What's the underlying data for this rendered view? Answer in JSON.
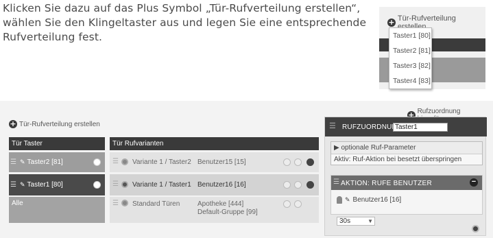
{
  "intro": {
    "text": "Klicken Sie dazu auf das Plus Symbol „Tür-Rufverteilung erstellen“, wählen Sie den Klingeltaster aus und legen Sie eine entsprechende Rufverteilung fest."
  },
  "inset": {
    "add_label": "Tür-Rufverteilung erstellen",
    "options": [
      "Taster1 [80]",
      "Taster2 [81]",
      "Taster3 [82]",
      "Taster4 [83]"
    ]
  },
  "app": {
    "add_label": "Tür-Rufverteilung erstellen",
    "add_assignment_label": "Rufzuordnung hinzufügen",
    "col_taster": "Tür Taster",
    "col_variants": "Tür Rufvarianten",
    "taster": [
      {
        "label": "Taster2 [81]"
      },
      {
        "label": "Taster1 [80]"
      },
      {
        "label": "Alle"
      }
    ],
    "variants": [
      {
        "name": "Variante 1 / Taster2",
        "user": "Benutzer15 [15]",
        "user2": ""
      },
      {
        "name": "Variante 1 / Taster1",
        "user": "Benutzer16 [16]",
        "user2": ""
      },
      {
        "name": "Standard Türen",
        "user": "Apotheke [444]",
        "user2": "Default-Gruppe [99]"
      }
    ],
    "panel": {
      "title": "RUFZUORDNUNG",
      "input_value": "Taster1",
      "params_label": "optionale Ruf-Parameter",
      "params_value": "Aktiv: Ruf-Aktion bei besetzt überspringen",
      "action_label": "AKTION: RUFE BENUTZER",
      "action_user": "Benutzer16 [16]",
      "delay": "30s"
    }
  }
}
